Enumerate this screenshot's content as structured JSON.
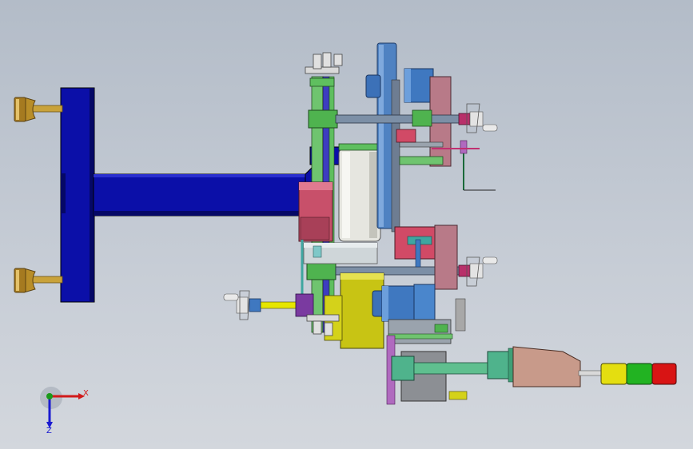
{
  "viewport": {
    "background_top": "#b3bcc8",
    "background_bottom": "#d3d7dd"
  },
  "triad": {
    "x_label": "X",
    "z_label": "Z",
    "x_color": "#d11a1a",
    "y_color": "#1a9a1a",
    "z_color": "#1a1ad1"
  },
  "colors": {
    "frame_blue": "#0b0fa8",
    "frame_blue_dark": "#050866",
    "brass": "#c9a23a",
    "green": "#5fbf5f",
    "mauve": "#b86a8a",
    "pink_red": "#c8506a",
    "roller_white": "#e6e6e0",
    "steel_blue": "#4f82c2",
    "yellow": "#d4d21a",
    "tan": "#c89a8a",
    "grey": "#8c8f94",
    "teal": "#3fa6a0",
    "stack_yellow": "#e4de10",
    "stack_green": "#22b322",
    "stack_red": "#d81414"
  },
  "model": {
    "components": [
      "main-frame",
      "leveling-foot-top",
      "leveling-foot-bottom",
      "support-arm",
      "idler-roller",
      "drive-motor",
      "belt-plate",
      "cylinder-upper",
      "cylinder-lower",
      "lower-motor",
      "yellow-base-block",
      "push-cylinder",
      "signal-tower"
    ]
  }
}
